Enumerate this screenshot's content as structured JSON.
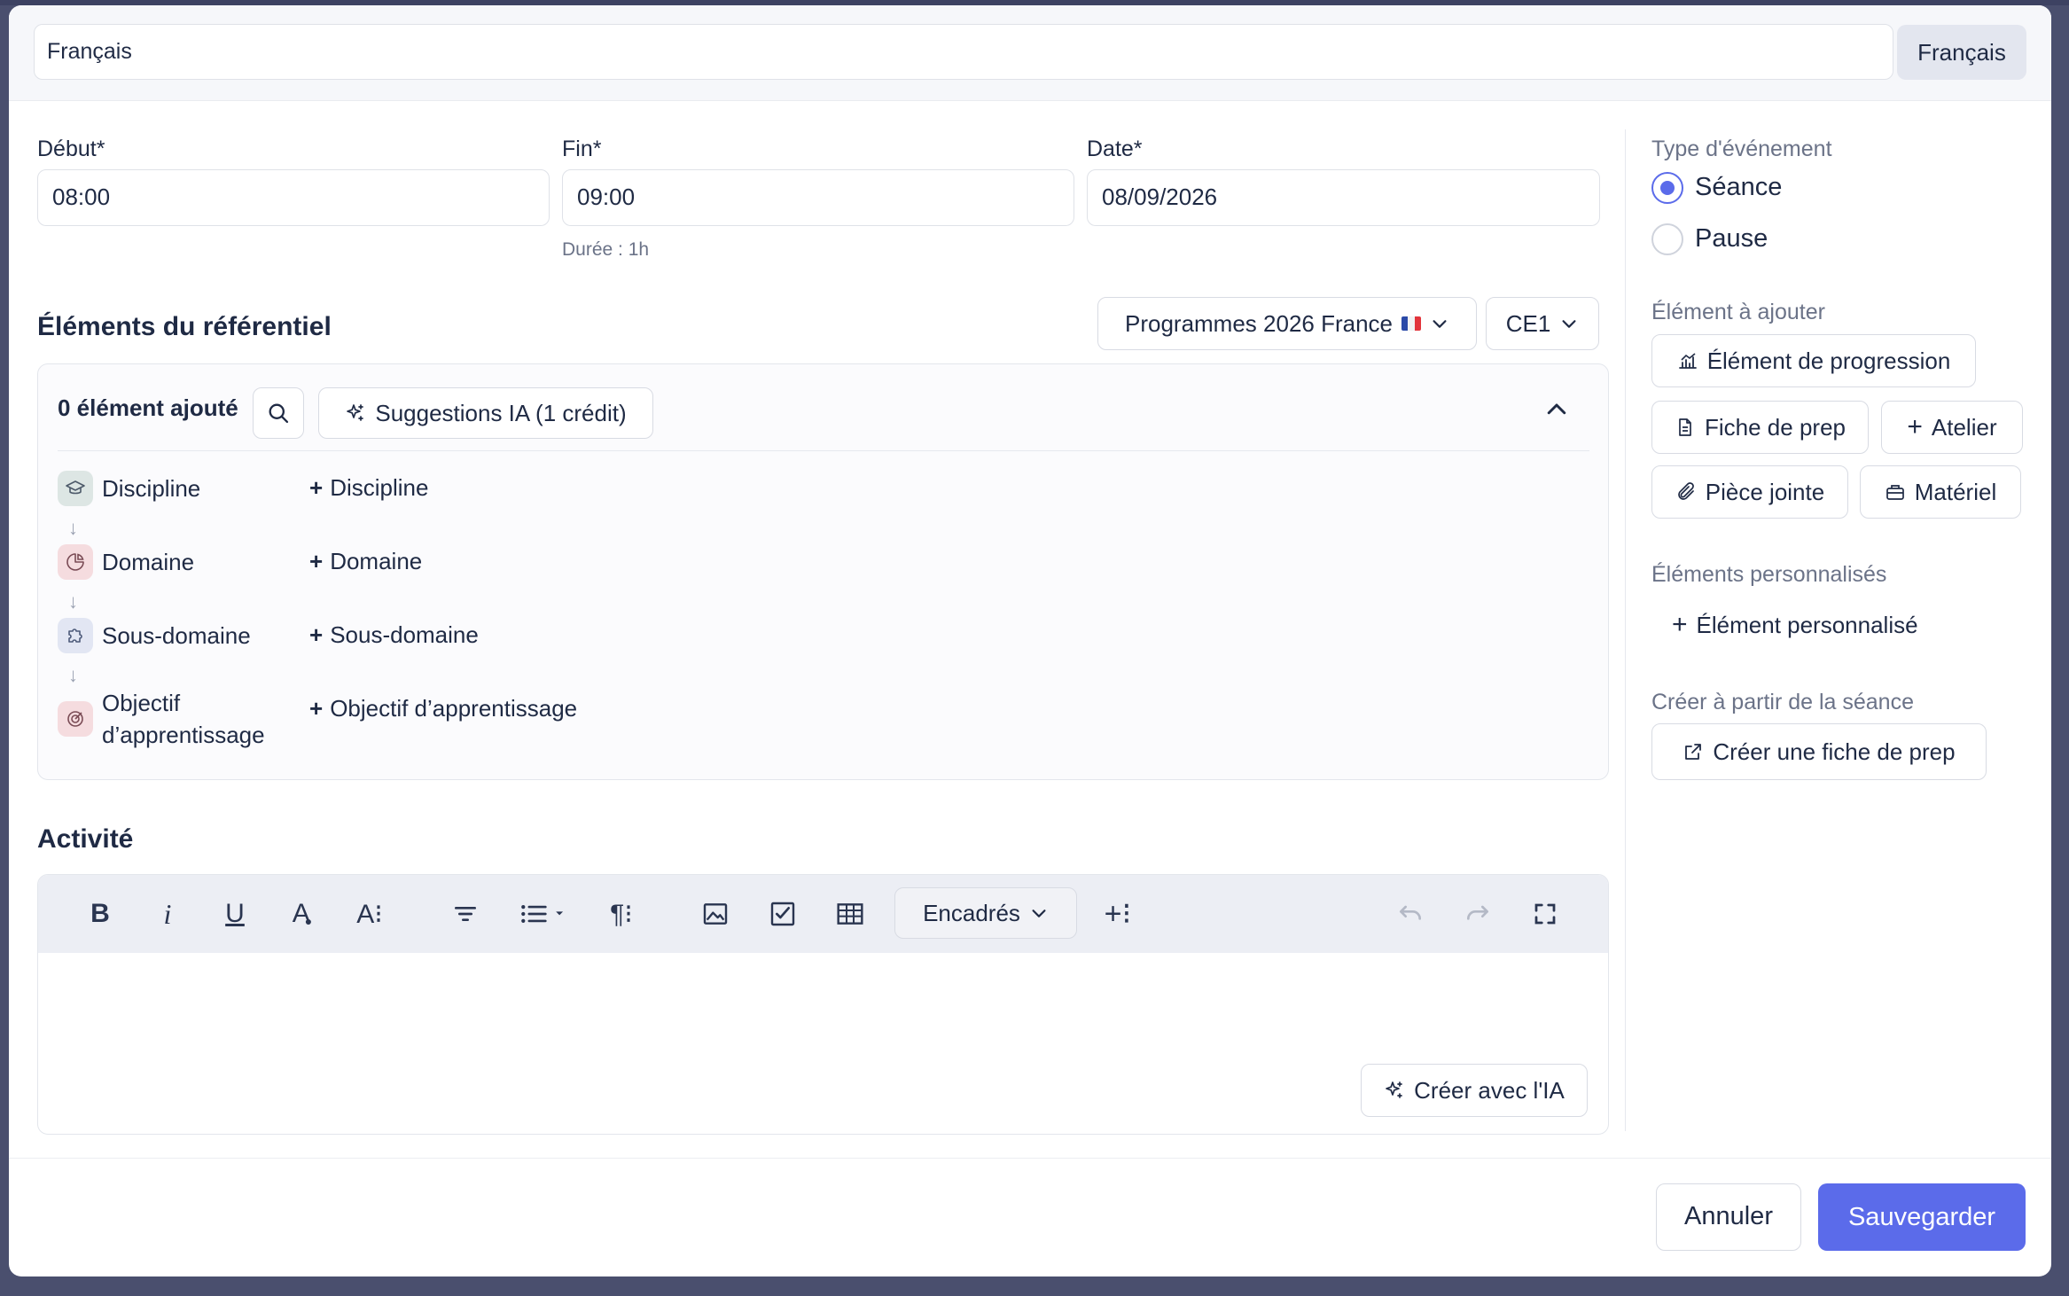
{
  "header": {
    "language_value": "Français",
    "language_button": "Français"
  },
  "timing": {
    "start_label": "Début*",
    "start_value": "08:00",
    "end_label": "Fin*",
    "end_value": "09:00",
    "date_label": "Date*",
    "date_value": "08/09/2026",
    "duration_hint": "Durée : 1h"
  },
  "referentiel": {
    "title": "Éléments du référentiel",
    "program_select": "Programmes 2026 France",
    "level_select": "CE1",
    "count_label": "0 élément ajouté",
    "ai_suggestions_button": "Suggestions IA (1 crédit)",
    "tree": [
      {
        "label": "Discipline",
        "add": "Discipline",
        "icon": "graduation-cap-icon",
        "color": "#dde6e4"
      },
      {
        "label": "Domaine",
        "add": "Domaine",
        "icon": "pie-chart-icon",
        "color": "#f5dcdf"
      },
      {
        "label": "Sous-domaine",
        "add": "Sous-domaine",
        "icon": "puzzle-icon",
        "color": "#e2e6f3"
      },
      {
        "label_line1": "Objectif",
        "label_line2": "d’apprentissage",
        "add": "Objectif d’apprentissage",
        "icon": "target-icon",
        "color": "#f5dcdf"
      }
    ]
  },
  "activity": {
    "title": "Activité",
    "blocks_select": "Encadrés",
    "ai_create_button": "Créer avec l'IA"
  },
  "sidebar": {
    "event_type_label": "Type d'événement",
    "event_types": [
      "Séance",
      "Pause"
    ],
    "selected_event_type": "Séance",
    "add_element_label": "Élément à ajouter",
    "progression_button": "Élément de progression",
    "prep_sheet_button": "Fiche de prep",
    "workshop_button": "Atelier",
    "attachment_button": "Pièce jointe",
    "material_button": "Matériel",
    "custom_elements_label": "Éléments personnalisés",
    "custom_element_button": "Élément personnalisé",
    "create_from_label": "Créer à partir de la séance",
    "create_prep_button": "Créer une fiche de prep"
  },
  "footer": {
    "cancel": "Annuler",
    "save": "Sauvegarder"
  },
  "colors": {
    "accent": "#5b6bea",
    "text": "#1f2a44"
  }
}
